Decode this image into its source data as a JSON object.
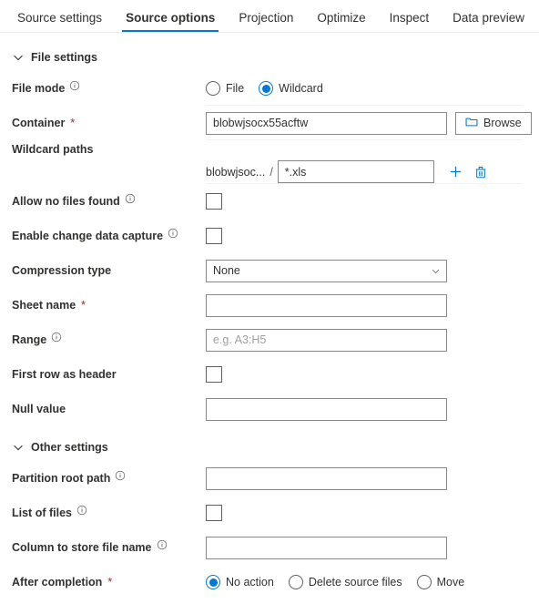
{
  "tabs": [
    {
      "label": "Source settings",
      "active": false
    },
    {
      "label": "Source options",
      "active": true
    },
    {
      "label": "Projection",
      "active": false
    },
    {
      "label": "Optimize",
      "active": false
    },
    {
      "label": "Inspect",
      "active": false
    },
    {
      "label": "Data preview",
      "active": false
    }
  ],
  "colors": {
    "accent": "#0078d4",
    "required": "#a4262c",
    "text": "#323130",
    "border": "#8a8886",
    "separator": "#f3f2f1"
  },
  "sections": {
    "file_settings": {
      "title": "File settings",
      "expanded": true
    },
    "other_settings": {
      "title": "Other settings",
      "expanded": true
    }
  },
  "file_settings": {
    "file_mode": {
      "label": "File mode",
      "has_info": true,
      "options": [
        {
          "label": "File",
          "selected": false
        },
        {
          "label": "Wildcard",
          "selected": true
        }
      ]
    },
    "container": {
      "label": "Container",
      "required": true,
      "value": "blobwjsocx55acftw",
      "browse_label": "Browse",
      "browse_icon": "folder-icon"
    },
    "wildcard_paths": {
      "label": "Wildcard paths",
      "prefix": "blobwjsoc...",
      "separator": "/",
      "value": "*.xls",
      "add_icon": "plus-icon",
      "delete_icon": "trash-icon"
    },
    "allow_no_files_found": {
      "label": "Allow no files found",
      "has_info": true,
      "checked": false
    },
    "enable_change_data_capture": {
      "label": "Enable change data capture",
      "has_info": true,
      "checked": false
    },
    "compression_type": {
      "label": "Compression type",
      "value": "None",
      "arrow_icon": "chevron-down-icon"
    },
    "sheet_name": {
      "label": "Sheet name",
      "required": true,
      "value": "",
      "placeholder": ""
    },
    "range": {
      "label": "Range",
      "has_info": true,
      "value": "",
      "placeholder": "e.g. A3:H5"
    },
    "first_row_as_header": {
      "label": "First row as header",
      "checked": false
    },
    "null_value": {
      "label": "Null value",
      "value": "",
      "placeholder": ""
    }
  },
  "other_settings": {
    "partition_root_path": {
      "label": "Partition root path",
      "has_info": true,
      "value": "",
      "placeholder": ""
    },
    "list_of_files": {
      "label": "List of files",
      "has_info": true,
      "checked": false
    },
    "column_to_store_file_name": {
      "label": "Column to store file name",
      "has_info": true,
      "value": "",
      "placeholder": ""
    },
    "after_completion": {
      "label": "After completion",
      "required": true,
      "options": [
        {
          "label": "No action",
          "selected": true
        },
        {
          "label": "Delete source files",
          "selected": false
        },
        {
          "label": "Move",
          "selected": false
        }
      ]
    }
  }
}
